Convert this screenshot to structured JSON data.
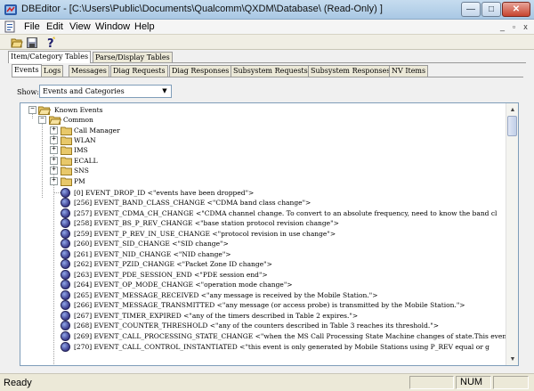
{
  "window": {
    "title": "DBEditor - [C:\\Users\\Public\\Documents\\Qualcomm\\QXDM\\Database\\ (Read-Only) ]",
    "minimize_glyph": "—",
    "maximize_glyph": "□",
    "close_glyph": "✕"
  },
  "menu": {
    "items": [
      "File",
      "Edit",
      "View",
      "Window",
      "Help"
    ],
    "mdi_minimize": "_",
    "mdi_restore": "▫",
    "mdi_close": "x"
  },
  "toolbar": {
    "icons": [
      "open-folder-icon",
      "save-icon",
      "help-icon"
    ]
  },
  "top_tabs": [
    "Item/Category Tables",
    "Parse/Display Tables"
  ],
  "sub_tabs": [
    "Events",
    "Logs",
    "Messages",
    "Diag Requests",
    "Diag Responses",
    "Subsystem Requests",
    "Subsystem Responses",
    "NV Items"
  ],
  "show": {
    "label": "Show:",
    "value": "Events and Categories",
    "arrow": "▼"
  },
  "tree": {
    "root": "Known Events",
    "group": "Common",
    "categories": [
      "Call Manager",
      "WLAN",
      "IMS",
      "ECALL",
      "SNS",
      "PM"
    ],
    "events": [
      "[0]   EVENT_DROP_ID  <\"events have been dropped\">",
      "[256]  EVENT_BAND_CLASS_CHANGE   <\"CDMA band class change\">",
      "[257]  EVENT_CDMA_CH_CHANGE   <\"CDMA channel change. To convert to an absolute frequency, need to know the band cl",
      "[258]  EVENT_BS_P_REV_CHANGE   <\"base station protocol revision change\">",
      "[259]  EVENT_P_REV_IN_USE_CHANGE   <\"protocol revision in use change\">",
      "[260]  EVENT_SID_CHANGE   <\"SID change\">",
      "[261]  EVENT_NID_CHANGE   <\"NID change\">",
      "[262]  EVENT_PZID_CHANGE   <\"Packet Zone ID change\">",
      "[263]  EVENT_PDE_SESSION_END   <\"PDE session end\">",
      "[264]  EVENT_OP_MODE_CHANGE   <\"operation mode change\">",
      "[265]  EVENT_MESSAGE_RECEIVED   <\"any message is received by the Mobile Station.\">",
      "[266]  EVENT_MESSAGE_TRANSMITTED   <\"any message (or access probe) is transmitted by the Mobile Station.\">",
      "[267]  EVENT_TIMER_EXPIRED   <\"any of the timers described in Table 2 expires.\">",
      "[268]  EVENT_COUNTER_THRESHOLD   <\"any of the counters described in Table 3 reaches its threshold.\">",
      "[269]  EVENT_CALL_PROCESSING_STATE_CHANGE   <\"when the MS Call Processing State Machine changes of state.This even",
      "[270]  EVENT_CALL_CONTROL_INSTANTIATED   <\"this event is only generated by Mobile Stations using P_REV equal or g"
    ],
    "expanded_glyph": "−",
    "collapsed_glyph": "+"
  },
  "status": {
    "text": "Ready",
    "num": "NUM"
  },
  "colors": {
    "titlebar": "#c6dcef",
    "folder": "#e8c86a",
    "event_icon": "#3a3a8a"
  }
}
